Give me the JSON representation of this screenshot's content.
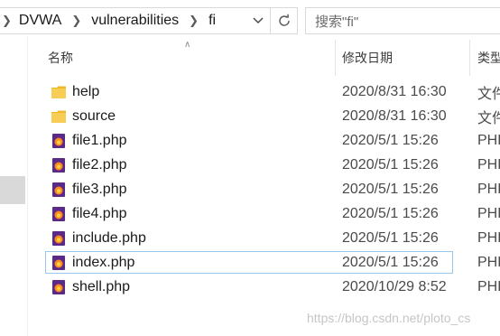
{
  "breadcrumb": {
    "items": [
      "DVWA",
      "vulnerabilities",
      "fi"
    ]
  },
  "search": {
    "placeholder": "搜索\"fi\""
  },
  "columns": {
    "name": "名称",
    "date": "修改日期",
    "type": "类型"
  },
  "files": [
    {
      "name": "help",
      "date": "2020/8/31 16:30",
      "type": "文件",
      "icon": "folder-icon"
    },
    {
      "name": "source",
      "date": "2020/8/31 16:30",
      "type": "文件",
      "icon": "folder-icon"
    },
    {
      "name": "file1.php",
      "date": "2020/5/1 15:26",
      "type": "PHP",
      "icon": "php-file-icon"
    },
    {
      "name": "file2.php",
      "date": "2020/5/1 15:26",
      "type": "PHP",
      "icon": "php-file-icon"
    },
    {
      "name": "file3.php",
      "date": "2020/5/1 15:26",
      "type": "PHP",
      "icon": "php-file-icon"
    },
    {
      "name": "file4.php",
      "date": "2020/5/1 15:26",
      "type": "PHP",
      "icon": "php-file-icon"
    },
    {
      "name": "include.php",
      "date": "2020/5/1 15:26",
      "type": "PHP",
      "icon": "php-file-icon"
    },
    {
      "name": "index.php",
      "date": "2020/5/1 15:26",
      "type": "PHP",
      "icon": "php-file-icon"
    },
    {
      "name": "shell.php",
      "date": "2020/10/29 8:52",
      "type": "PHP",
      "icon": "php-file-icon"
    }
  ],
  "watermark": "https://blog.csdn.net/ploto_cs",
  "colors": {
    "folder": "#f5c542",
    "php_bg": "#5b2a86",
    "php_flame": "#ff8a1c",
    "focus_border": "#99c9ef"
  }
}
